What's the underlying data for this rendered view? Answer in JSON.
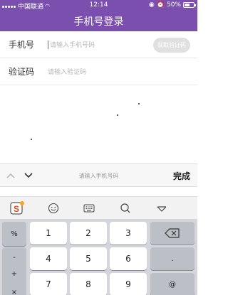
{
  "status_bar": {
    "carrier": "中国联通",
    "time": "12:14",
    "battery_percent_text": "50%",
    "battery_level": 0.5
  },
  "header": {
    "title": "手机号登录"
  },
  "form": {
    "phone": {
      "label": "手机号",
      "placeholder": "请输入手机号码",
      "button_label": "获取验证码"
    },
    "code": {
      "label": "验证码",
      "placeholder": "请输入验证码"
    }
  },
  "accessory_bar": {
    "hint": "请输入手机号码",
    "done_label": "完成"
  },
  "keyboard": {
    "left_keys": [
      "%",
      "-",
      "+",
      "×"
    ],
    "digit_rows": [
      [
        "1",
        "2",
        "3"
      ],
      [
        "4",
        "5",
        "6"
      ],
      [
        "7",
        "8",
        "9"
      ]
    ],
    "right_keys": [
      ".",
      "@"
    ]
  },
  "colors": {
    "brand": "#7b4fae",
    "keyboard_bg": "#d4d6db",
    "caret": "#3478f6"
  }
}
